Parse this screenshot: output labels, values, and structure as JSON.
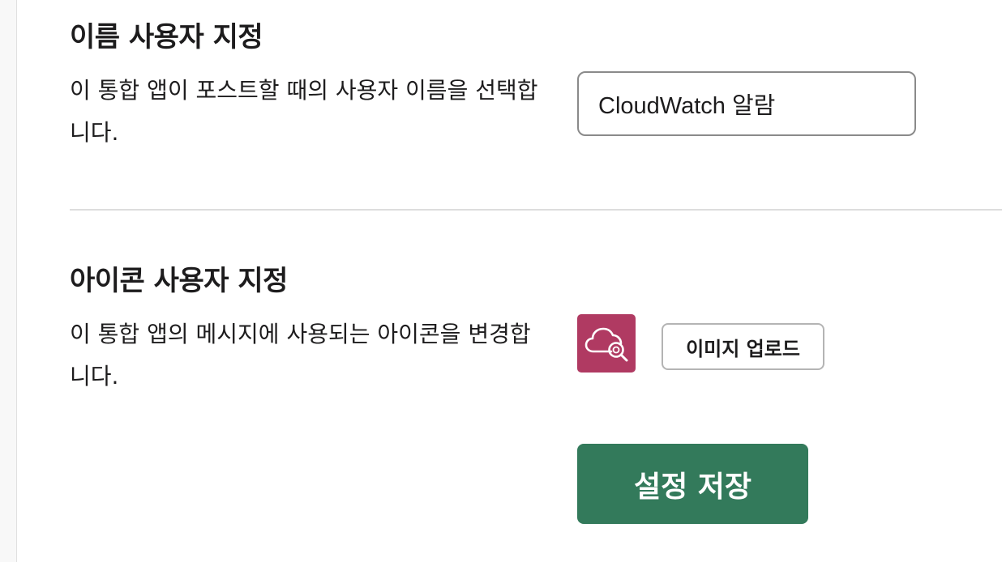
{
  "name_section": {
    "title": "이름 사용자 지정",
    "description": "이 통합 앱이 포스트할 때의 사용자 이름을 선택합니다.",
    "input_value": "CloudWatch 알람"
  },
  "icon_section": {
    "title": "아이콘 사용자 지정",
    "description": "이 통합 앱의 메시지에 사용되는 아이콘을 변경합니다.",
    "icon": "cloudwatch-icon",
    "icon_color": "#b03a62",
    "upload_label": "이미지 업로드"
  },
  "actions": {
    "save_label": "설정 저장",
    "save_color": "#337a5b"
  }
}
